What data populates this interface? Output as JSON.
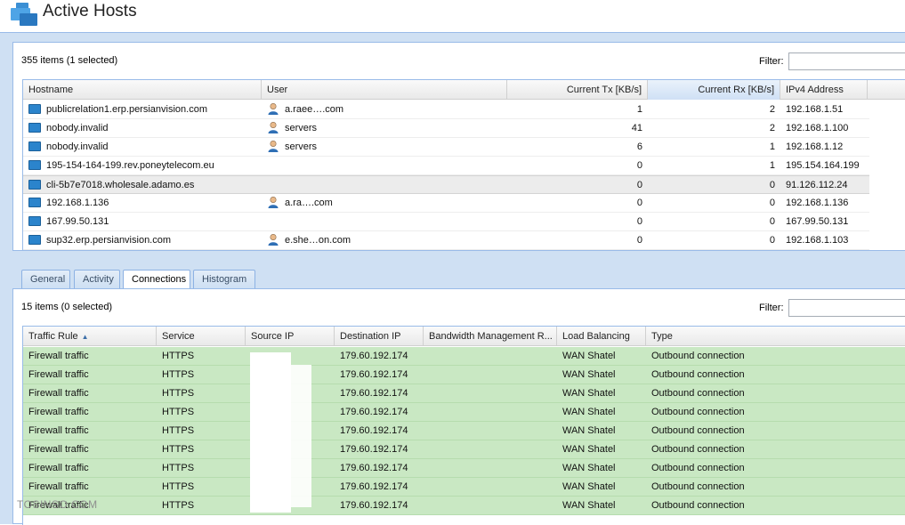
{
  "header": {
    "title": "Active Hosts"
  },
  "hosts_panel": {
    "items_count": "355 items (1 selected)",
    "filter_label": "Filter:",
    "filter_value": "",
    "columns": [
      "Hostname",
      "User",
      "Current Tx [KB/s]",
      "Current Rx [KB/s]",
      "IPv4 Address"
    ],
    "sorted_column": "Current Rx [KB/s]",
    "rows": [
      {
        "hostname": "publicrelation1.erp.persianvision.com",
        "user": "a.raee….com",
        "tx": "1",
        "rx": "2",
        "ip": "192.168.1.51",
        "has_user": true
      },
      {
        "hostname": "nobody.invalid",
        "user": "servers",
        "tx": "41",
        "rx": "2",
        "ip": "192.168.1.100",
        "has_user": true
      },
      {
        "hostname": "nobody.invalid",
        "user": "servers",
        "tx": "6",
        "rx": "1",
        "ip": "192.168.1.12",
        "has_user": true
      },
      {
        "hostname": "195-154-164-199.rev.poneytelecom.eu",
        "user": "",
        "tx": "0",
        "rx": "1",
        "ip": "195.154.164.199",
        "has_user": false
      },
      {
        "hostname": "cli-5b7e7018.wholesale.adamo.es",
        "user": "",
        "tx": "0",
        "rx": "0",
        "ip": "91.126.112.24",
        "has_user": false,
        "selected": true
      },
      {
        "hostname": "192.168.1.136",
        "user": "a.ra….com",
        "tx": "0",
        "rx": "0",
        "ip": "192.168.1.136",
        "has_user": true
      },
      {
        "hostname": "167.99.50.131",
        "user": "",
        "tx": "0",
        "rx": "0",
        "ip": "167.99.50.131",
        "has_user": false
      },
      {
        "hostname": "sup32.erp.persianvision.com",
        "user": "e.she…on.com",
        "tx": "0",
        "rx": "0",
        "ip": "192.168.1.103",
        "has_user": true
      }
    ]
  },
  "tabs": [
    "General",
    "Activity",
    "Connections",
    "Histogram"
  ],
  "active_tab": "Connections",
  "connections_panel": {
    "items_count": "15 items (0 selected)",
    "filter_label": "Filter:",
    "filter_value": "",
    "columns": [
      "Traffic Rule",
      "Service",
      "Source IP",
      "Destination IP",
      "Bandwidth Management R...",
      "Load Balancing",
      "Type"
    ],
    "sorted_column": "Traffic Rule",
    "rows": [
      {
        "rule": "Firewall traffic",
        "service": "HTTPS",
        "source": "",
        "dest": "179.60.192.174",
        "bw": "",
        "lb": "WAN Shatel",
        "type": "Outbound connection"
      },
      {
        "rule": "Firewall traffic",
        "service": "HTTPS",
        "source": "",
        "dest": "179.60.192.174",
        "bw": "",
        "lb": "WAN Shatel",
        "type": "Outbound connection"
      },
      {
        "rule": "Firewall traffic",
        "service": "HTTPS",
        "source": "",
        "dest": "179.60.192.174",
        "bw": "",
        "lb": "WAN Shatel",
        "type": "Outbound connection"
      },
      {
        "rule": "Firewall traffic",
        "service": "HTTPS",
        "source": "",
        "dest": "179.60.192.174",
        "bw": "",
        "lb": "WAN Shatel",
        "type": "Outbound connection"
      },
      {
        "rule": "Firewall traffic",
        "service": "HTTPS",
        "source": "",
        "dest": "179.60.192.174",
        "bw": "",
        "lb": "WAN Shatel",
        "type": "Outbound connection"
      },
      {
        "rule": "Firewall traffic",
        "service": "HTTPS",
        "source": "",
        "dest": "179.60.192.174",
        "bw": "",
        "lb": "WAN Shatel",
        "type": "Outbound connection"
      },
      {
        "rule": "Firewall traffic",
        "service": "HTTPS",
        "source": "",
        "dest": "179.60.192.174",
        "bw": "",
        "lb": "WAN Shatel",
        "type": "Outbound connection"
      },
      {
        "rule": "Firewall traffic",
        "service": "HTTPS",
        "source": "",
        "dest": "179.60.192.174",
        "bw": "",
        "lb": "WAN Shatel",
        "type": "Outbound connection"
      },
      {
        "rule": "Firewall traffic",
        "service": "HTTPS",
        "source": "",
        "dest": "179.60.192.174",
        "bw": "",
        "lb": "WAN Shatel",
        "type": "Outbound connection"
      }
    ]
  },
  "watermark": "TOSINSO.COM",
  "colors": {
    "frame": "#cfe0f3",
    "border": "#99bbe8",
    "green_row": "#c9e8c3",
    "host_icon": "#2b84cc"
  }
}
